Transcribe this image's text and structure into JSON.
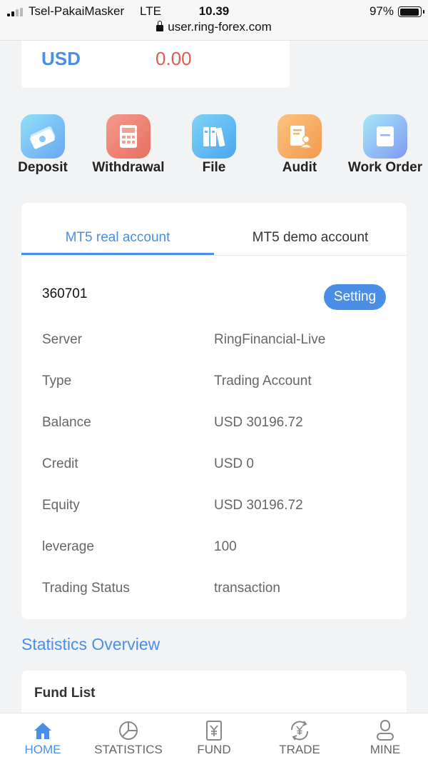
{
  "status_bar": {
    "carrier": "Tsel-PakaiMasker",
    "network": "LTE",
    "time": "10.39",
    "battery": "97%",
    "url": "user.ring-forex.com"
  },
  "balance": {
    "currency": "USD",
    "amount": "0.00"
  },
  "actions": [
    {
      "label": "Deposit",
      "icon": "money-icon"
    },
    {
      "label": "Withdrawal",
      "icon": "calculator-icon"
    },
    {
      "label": "File",
      "icon": "binders-icon"
    },
    {
      "label": "Audit",
      "icon": "document-user-icon"
    },
    {
      "label": "Work Order",
      "icon": "form-icon"
    }
  ],
  "account": {
    "tabs": [
      "MT5 real account",
      "MT5 demo account"
    ],
    "active_tab": 0,
    "number": "360701",
    "setting_label": "Setting",
    "rows": [
      {
        "key": "Server",
        "value": "RingFinancial-Live"
      },
      {
        "key": "Type",
        "value": "Trading Account"
      },
      {
        "key": "Balance",
        "value": "USD 30196.72"
      },
      {
        "key": "Credit",
        "value": "USD 0"
      },
      {
        "key": "Equity",
        "value": "USD 30196.72"
      },
      {
        "key": "leverage",
        "value": "100"
      },
      {
        "key": "Trading Status",
        "value": "transaction"
      }
    ]
  },
  "statistics": {
    "title": "Statistics Overview",
    "fund_list_title": "Fund List"
  },
  "nav": [
    {
      "label": "HOME",
      "icon": "home-icon"
    },
    {
      "label": "STATISTICS",
      "icon": "pie-chart-icon"
    },
    {
      "label": "FUND",
      "icon": "yen-document-icon"
    },
    {
      "label": "TRADE",
      "icon": "yen-exchange-icon"
    },
    {
      "label": "MINE",
      "icon": "user-icon"
    }
  ],
  "nav_active": 0,
  "colors": {
    "accent": "#4a8ee6",
    "negative": "#e25b4f",
    "background": "#f2f3f5"
  }
}
